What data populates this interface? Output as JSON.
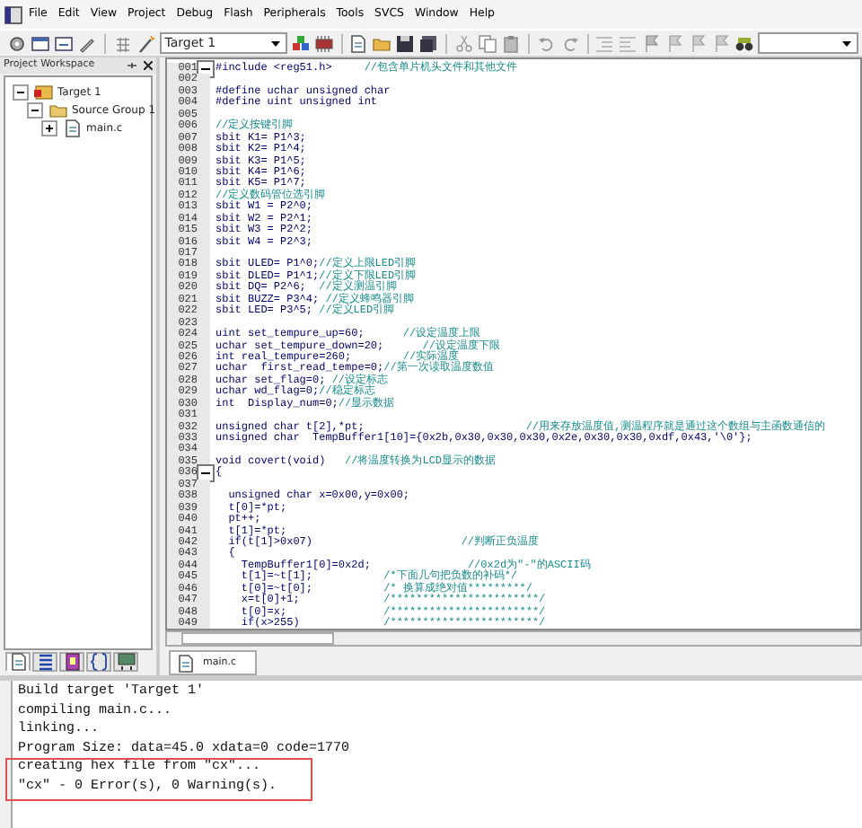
{
  "menu": [
    "File",
    "Edit",
    "View",
    "Project",
    "Debug",
    "Flash",
    "Peripherals",
    "Tools",
    "SVCS",
    "Window",
    "Help"
  ],
  "toolbar": {
    "target": "Target 1"
  },
  "workspace": {
    "title": "Project Workspace",
    "tree": [
      {
        "label": "Target 1",
        "expanded": true,
        "children": [
          {
            "label": "Source Group 1",
            "expanded": true,
            "children": [
              {
                "label": "main.c",
                "expanded": false
              }
            ]
          }
        ]
      }
    ],
    "tabs": [
      {
        "selected": true
      },
      {
        "selected": false
      },
      {
        "selected": false
      },
      {
        "selected": false
      },
      {
        "selected": false
      }
    ]
  },
  "editor": {
    "lines": [
      {
        "number": "001",
        "code": "#include <reg51.h>     ",
        "comment": "//包含单片机头文件和其他文件",
        "fold": true
      },
      {
        "number": "002",
        "fold": false
      },
      {
        "number": "003",
        "code": "#define uchar unsigned char",
        "fold": false
      },
      {
        "number": "004",
        "code": "#define uint unsigned int",
        "fold": false
      },
      {
        "number": "005",
        "fold": false
      },
      {
        "number": "006",
        "comment": "//定义按键引脚",
        "fold": false
      },
      {
        "number": "007",
        "code": "sbit K1= P1^3;",
        "fold": false
      },
      {
        "number": "008",
        "code": "sbit K2= P1^4;",
        "fold": false
      },
      {
        "number": "009",
        "code": "sbit K3= P1^5;",
        "fold": false
      },
      {
        "number": "010",
        "code": "sbit K4= P1^6;",
        "fold": false
      },
      {
        "number": "011",
        "code": "sbit K5= P1^7;",
        "fold": false
      },
      {
        "number": "012",
        "comment": "//定义数码管位选引脚",
        "fold": false
      },
      {
        "number": "013",
        "code": "sbit W1 = P2^0;",
        "fold": false
      },
      {
        "number": "014",
        "code": "sbit W2 = P2^1;",
        "fold": false
      },
      {
        "number": "015",
        "code": "sbit W3 = P2^2;",
        "fold": false
      },
      {
        "number": "016",
        "code": "sbit W4 = P2^3;",
        "fold": false
      },
      {
        "number": "017",
        "fold": false
      },
      {
        "number": "018",
        "code": "sbit ULED= P1^0;",
        "comment": "//定义上限LED引脚",
        "fold": false
      },
      {
        "number": "019",
        "code": "sbit DLED= P1^1;",
        "comment": "//定义下限LED引脚",
        "fold": false
      },
      {
        "number": "020",
        "code": "sbit DQ= P2^6;  ",
        "comment": "//定义测温引脚",
        "fold": false
      },
      {
        "number": "021",
        "code": "sbit BUZZ= P3^4; ",
        "comment": "//定义蜂鸣器引脚",
        "fold": false
      },
      {
        "number": "022",
        "code": "sbit LED= P3^5; ",
        "comment": "//定义LED引脚",
        "fold": false
      },
      {
        "number": "023",
        "fold": false
      },
      {
        "number": "024",
        "code": "uint set_tempure_up=60;      ",
        "comment": "//设定温度上限",
        "fold": false
      },
      {
        "number": "025",
        "code": "uchar set_tempure_down=20;      ",
        "comment": "//设定温度下限",
        "fold": false
      },
      {
        "number": "026",
        "code": "int real_tempure=260;        ",
        "comment": "//实际温度",
        "fold": false
      },
      {
        "number": "027",
        "code": "uchar  first_read_tempe=0;",
        "comment": "//第一次读取温度数值",
        "fold": false
      },
      {
        "number": "028",
        "code": "uchar set_flag=0; ",
        "comment": "//设定标志",
        "fold": false
      },
      {
        "number": "029",
        "code": "uchar wd_flag=0;",
        "comment": "//稳定标志",
        "fold": false
      },
      {
        "number": "030",
        "code": "int  Display_num=0;",
        "comment": "//显示数据",
        "fold": false
      },
      {
        "number": "031",
        "fold": false
      },
      {
        "number": "032",
        "code": "unsigned char t[2],*pt;                         ",
        "comment": "//用来存放温度值,测温程序就是通过这个数组与主函数通信的",
        "fold": false
      },
      {
        "number": "033",
        "code": "unsigned char  TempBuffer1[10]={0x2b,0x30,0x30,0x30,0x2e,0x30,0x30,0xdf,0x43,'\\0'};",
        "fold": false
      },
      {
        "number": "034",
        "fold": false
      },
      {
        "number": "035",
        "code": "void covert(void)   ",
        "comment": "//将温度转换为LCD显示的数据",
        "fold": false
      },
      {
        "number": "036",
        "code": "{",
        "fold": true
      },
      {
        "number": "037",
        "fold": false
      },
      {
        "number": "038",
        "code": "  unsigned char x=0x00,y=0x00;",
        "fold": false
      },
      {
        "number": "039",
        "code": "  t[0]=*pt;",
        "fold": false
      },
      {
        "number": "040",
        "code": "  pt++;",
        "fold": false
      },
      {
        "number": "041",
        "code": "  t[1]=*pt;",
        "fold": false
      },
      {
        "number": "042",
        "code": "  if(t[1]>0x07)                       ",
        "comment": "//判断正负温度",
        "fold": false
      },
      {
        "number": "043",
        "code": "  {",
        "fold": false
      },
      {
        "number": "044",
        "code": "    TempBuffer1[0]=0x2d;               ",
        "comment": "//0x2d为\"-\"的ASCII码",
        "fold": false
      },
      {
        "number": "045",
        "code": "    t[1]=~t[1];           ",
        "comment": "/*下面几句把负数的补码*/",
        "fold": false
      },
      {
        "number": "046",
        "code": "    t[0]=~t[0];           ",
        "comment": "/* 换算成绝对值*********/",
        "fold": false
      },
      {
        "number": "047",
        "code": "    x=t[0]+1;             ",
        "comment": "/***********************/",
        "fold": false
      },
      {
        "number": "048",
        "code": "    t[0]=x;               ",
        "comment": "/***********************/",
        "fold": false
      },
      {
        "number": "049",
        "code": "    if(x>255)             ",
        "comment": "/***********************/",
        "fold": false
      }
    ],
    "tabs": [
      {
        "label": "main.c",
        "selected": true
      }
    ]
  },
  "output": {
    "lines": [
      "Build target 'Target 1'",
      "compiling main.c...",
      "linking...",
      "Program Size: data=45.0 xdata=0 code=1770",
      "creating hex file from \"cx\"...",
      "\"cx\" - 0 Error(s), 0 Warning(s)."
    ]
  }
}
